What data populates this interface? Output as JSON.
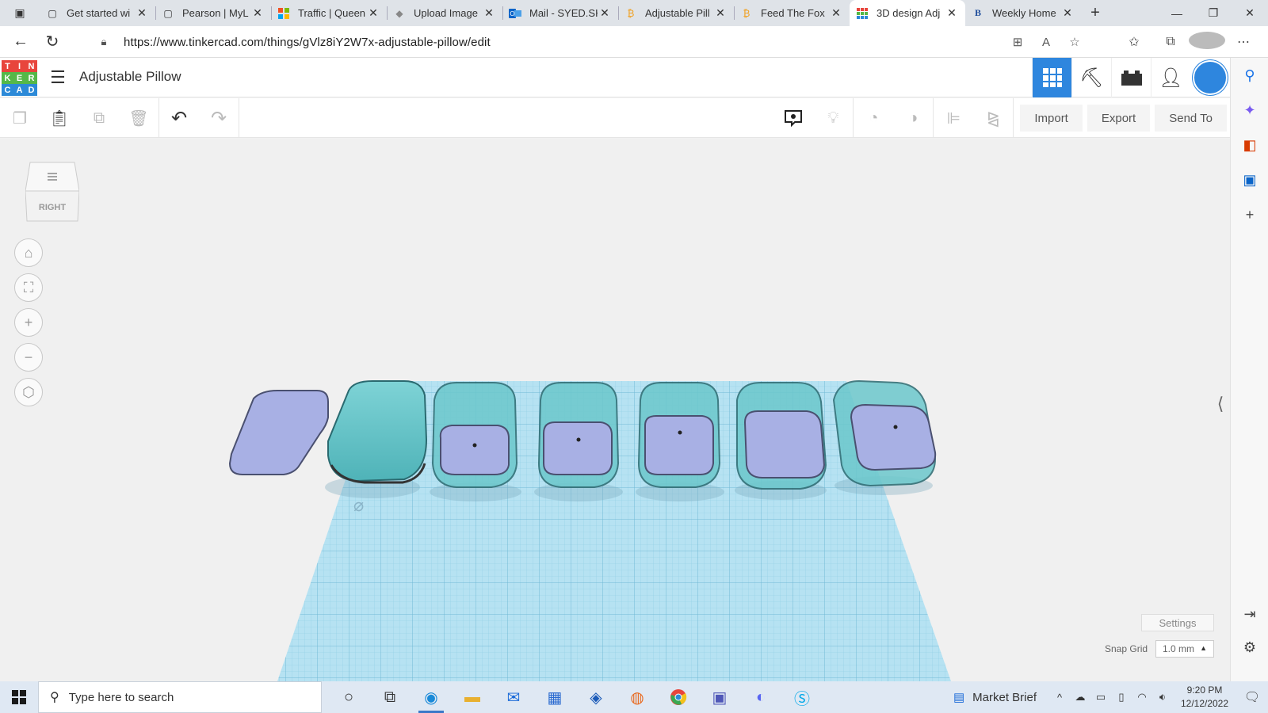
{
  "browser": {
    "tabs": [
      {
        "title": "Get started wi",
        "icon": "page-icon",
        "active": false
      },
      {
        "title": "Pearson | MyL",
        "icon": "page-icon",
        "active": false
      },
      {
        "title": "Traffic | Queen",
        "icon": "microsoft-icon",
        "active": false
      },
      {
        "title": "Upload Image",
        "icon": "upload-icon",
        "active": false
      },
      {
        "title": "Mail - SYED.SH",
        "icon": "outlook-icon",
        "active": false
      },
      {
        "title": "Adjustable Pill",
        "icon": "bitcoin-icon",
        "active": false
      },
      {
        "title": "Feed The Fox",
        "icon": "bitcoin-icon",
        "active": false
      },
      {
        "title": "3D design Adj",
        "icon": "tinkercad-icon",
        "active": true
      },
      {
        "title": "Weekly Home",
        "icon": "b-icon",
        "active": false
      }
    ],
    "url": "https://www.tinkercad.com/things/gVlz8iY2W7x-adjustable-pillow/edit"
  },
  "tinkercad": {
    "logo_letters": [
      "T",
      "I",
      "N",
      "K",
      "E",
      "R",
      "C",
      "A",
      "D"
    ],
    "logo_colors": [
      "#e8453c",
      "#e8453c",
      "#e8453c",
      "#55b848",
      "#55b848",
      "#55b848",
      "#2c8ad8",
      "#2c8ad8",
      "#2c8ad8"
    ],
    "design_title": "Adjustable Pillow",
    "toolbar": {
      "import_label": "Import",
      "export_label": "Export",
      "send_to_label": "Send To"
    },
    "viewcube_face": "RIGHT",
    "settings_label": "Settings",
    "snap_grid_label": "Snap Grid",
    "snap_grid_value": "1.0 mm",
    "accent_color": "#2e86de",
    "workplane_color": "#a9dcef",
    "shape_teal": "#6cc8cc",
    "shape_lavender": "#a8b0e4"
  },
  "taskbar": {
    "search_placeholder": "Type here to search",
    "news_label": "Market Brief",
    "time": "9:20 PM",
    "date": "12/12/2022"
  }
}
